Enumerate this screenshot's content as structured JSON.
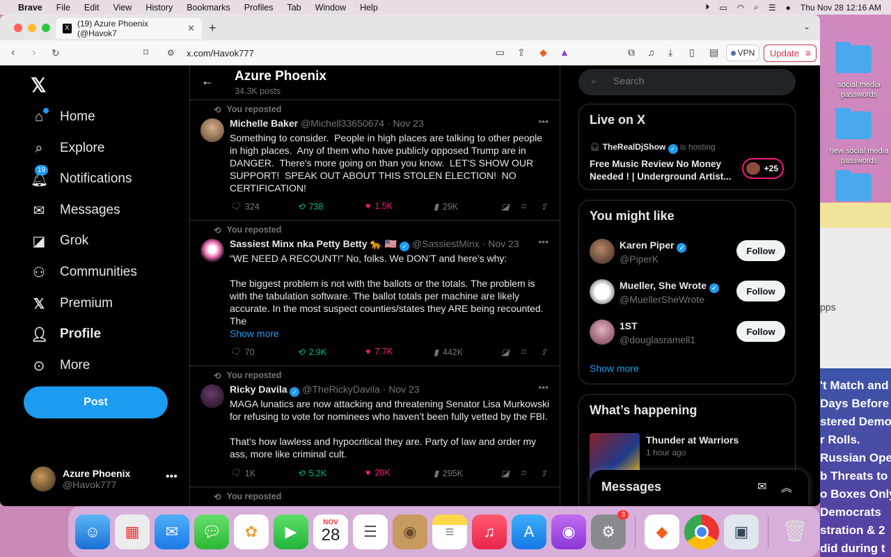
{
  "menubar": {
    "app": "Brave",
    "items": [
      "File",
      "Edit",
      "View",
      "History",
      "Bookmarks",
      "Profiles",
      "Tab",
      "Window",
      "Help"
    ],
    "datetime": "Thu Nov 28  12:16 AM"
  },
  "desktop": {
    "folder1": "social media passwords",
    "folder2": "new social media passwords",
    "partial_gray": "pps",
    "partial_headlines": [
      "'t Match and",
      "Days Before",
      "stered Demo",
      "r Rolls.",
      "Russian Ope",
      "b Threats to",
      "o Boxes Only",
      "Democrats",
      "stration & 2",
      "did during t"
    ]
  },
  "browser": {
    "tab_title": "(19) Azure Phoenix (@Havok7",
    "url": "x.com/Havok777",
    "vpn_label": "VPN",
    "update_label": "Update"
  },
  "nav": {
    "home": "Home",
    "explore": "Explore",
    "notifications": "Notifications",
    "notifications_badge": "19",
    "messages": "Messages",
    "grok": "Grok",
    "communities": "Communities",
    "premium": "Premium",
    "profile": "Profile",
    "more": "More",
    "post": "Post",
    "me_name": "Azure Phoenix",
    "me_handle": "@Havok777"
  },
  "profile_header": {
    "name": "Azure Phoenix",
    "posts": "34.3K posts"
  },
  "tweets": [
    {
      "reposted": "You reposted",
      "name": "Michelle Baker",
      "handle": "@Michell33650674",
      "date": "Nov 23",
      "text": "Something to consider.  People in high places are talking to other people in high places.  Any of them who have publicly opposed Trump are in DANGER.  There's more going on than you know.  LET'S SHOW OUR SUPPORT!  SPEAK OUT ABOUT THIS STOLEN ELECTION!  NO CERTIFICATION!",
      "show_more": "",
      "replies": "324",
      "reposts": "738",
      "likes": "1.5K",
      "views": "29K"
    },
    {
      "reposted": "You reposted",
      "name": "Sassiest Minx nka Petty Betty 🐆 🇺🇸",
      "handle": "@SassiestMinx",
      "date": "Nov 23",
      "text": "“WE NEED A RECOUNT!” No, folks. We DON’T and here’s why:\n\nThe biggest problem is not with the ballots or the totals. The problem is with the tabulation software. The ballot totals per machine are likely accurate. In the most suspect counties/states they ARE being recounted. The",
      "show_more": "Show more",
      "replies": "70",
      "reposts": "2.9K",
      "likes": "7.7K",
      "views": "442K"
    },
    {
      "reposted": "You reposted",
      "name": "Ricky Davila",
      "handle": "@TheRickyDavila",
      "date": "Nov 23",
      "text": "MAGA lunatics are now attacking and threatening Senator Lisa Murkowski for refusing to vote for nominees who haven’t been fully vetted by the FBI.\n\nThat’s how lawless and hypocritical they are. Party of law and order my ass, more like criminal cult.",
      "show_more": "",
      "replies": "1K",
      "reposts": "5.2K",
      "likes": "20K",
      "views": "295K"
    },
    {
      "reposted": "You reposted"
    }
  ],
  "search": {
    "placeholder": "Search"
  },
  "live": {
    "title": "Live on X",
    "host": "TheRealDjShow",
    "host_suffix": "is hosting",
    "space_title": "Free Music Review No Money Needed ! | Underground Artist...",
    "listeners": "+25"
  },
  "who_to_follow": {
    "title": "You might like",
    "users": [
      {
        "name": "Karen Piper",
        "handle": "@PiperK",
        "follow": "Follow"
      },
      {
        "name": "Mueller, She Wrote",
        "handle": "@MuellerSheWrote",
        "follow": "Follow"
      },
      {
        "name": "1ST",
        "handle": "@douglasramell1",
        "follow": "Follow"
      }
    ],
    "show_more": "Show more"
  },
  "happening": {
    "title": "What’s happening",
    "trend": "Thunder at Warriors",
    "time": "1 hour ago"
  },
  "messages_drawer": {
    "title": "Messages"
  },
  "dock": {
    "calendar_month": "NOV",
    "calendar_day": "28",
    "settings_badge": "3"
  }
}
